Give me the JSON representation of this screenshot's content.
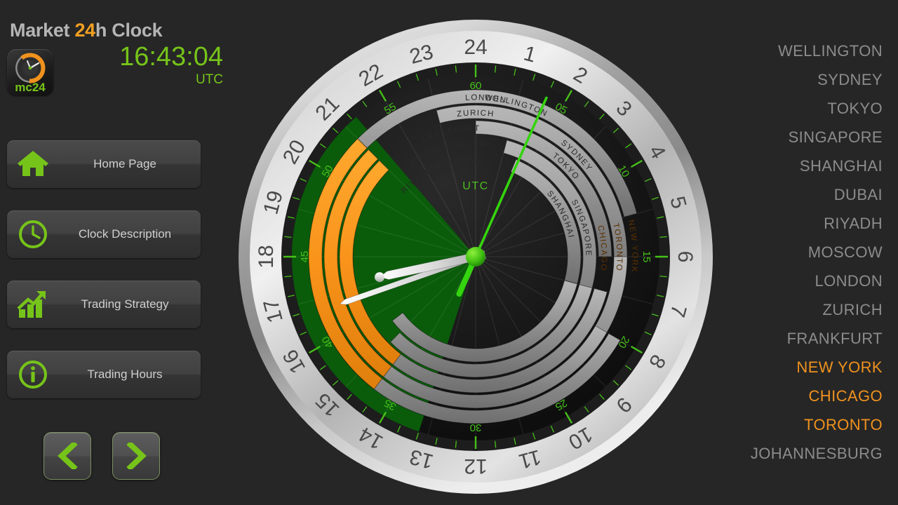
{
  "header": {
    "title_prefix": "Market ",
    "title_accent": "24",
    "title_suffix": "h Clock",
    "time": "16:43:04",
    "timezone": "UTC",
    "logo_text": "mc24"
  },
  "menu": {
    "items": [
      {
        "label": "Home Page",
        "icon": "home-icon"
      },
      {
        "label": "Clock Description",
        "icon": "clock-icon"
      },
      {
        "label": "Trading Strategy",
        "icon": "chart-growth-icon"
      },
      {
        "label": "Trading Hours",
        "icon": "info-icon"
      }
    ]
  },
  "pagination": {
    "previous_icon": "chevron-left-icon",
    "next_icon": "chevron-right-icon"
  },
  "colors": {
    "accent_orange": "#f0921e",
    "accent_green": "#76c419",
    "dial_green_sector": "#0a5c0a",
    "text_grey": "#8c8c8c",
    "background": "#262626"
  },
  "clock": {
    "center_label": "UTC",
    "hour_numerals": [
      "1",
      "2",
      "3",
      "4",
      "5",
      "6",
      "7",
      "8",
      "9",
      "10",
      "11",
      "12",
      "13",
      "14",
      "15",
      "16",
      "17",
      "18",
      "19",
      "20",
      "21",
      "22",
      "23",
      "24"
    ],
    "minute_numerals": [
      "60",
      "05",
      "10",
      "15",
      "20",
      "25",
      "30",
      "35",
      "40",
      "45",
      "50",
      "55"
    ],
    "hour_hand_value": 16.72,
    "minute_hand_value": 43,
    "second_hand_value": 4,
    "open_sector_start_hour": 13.2,
    "open_sector_end_hour": 21.3
  },
  "market_arcs": [
    {
      "city": "WELLINGTON",
      "ring": 0,
      "start_hour": 21.0,
      "end_hour": 5.0,
      "status": "closed"
    },
    {
      "city": "SYDNEY",
      "ring": 1,
      "start_hour": 23.0,
      "end_hour": 7.0,
      "status": "closed"
    },
    {
      "city": "TOKYO",
      "ring": 2,
      "start_hour": 0.0,
      "end_hour": 6.0,
      "status": "closed"
    },
    {
      "city": "SINGAPORE",
      "ring": 3,
      "start_hour": 1.0,
      "end_hour": 9.0,
      "status": "closed"
    },
    {
      "city": "SHANGHAI",
      "ring": 4,
      "start_hour": 1.5,
      "end_hour": 7.0,
      "status": "closed"
    },
    {
      "city": "DUBAI",
      "ring": 1,
      "start_hour": 6.0,
      "end_hour": 11.0,
      "status": "closed"
    },
    {
      "city": "RIYADH",
      "ring": 4,
      "start_hour": 7.0,
      "end_hour": 12.0,
      "status": "closed"
    },
    {
      "city": "MOSCOW",
      "ring": 4,
      "start_hour": 7.0,
      "end_hour": 15.5,
      "status": "closed"
    },
    {
      "city": "JOHANNESBURG",
      "ring": 3,
      "start_hour": 7.0,
      "end_hour": 15.0,
      "status": "closed"
    },
    {
      "city": "FRANKFURT",
      "ring": 2,
      "start_hour": 7.0,
      "end_hour": 15.5,
      "status": "closed"
    },
    {
      "city": "ZURICH",
      "ring": 1,
      "start_hour": 8.0,
      "end_hour": 16.0,
      "status": "closed"
    },
    {
      "city": "LONDON",
      "ring": 0,
      "start_hour": 8.0,
      "end_hour": 16.5,
      "status": "closed"
    },
    {
      "city": "NEW YORK",
      "ring": 0,
      "start_hour": 14.5,
      "end_hour": 21.0,
      "status": "open"
    },
    {
      "city": "TORONTO",
      "ring": 1,
      "start_hour": 14.5,
      "end_hour": 21.0,
      "status": "open"
    },
    {
      "city": "CHICAGO",
      "ring": 2,
      "start_hour": 14.5,
      "end_hour": 21.0,
      "status": "open"
    }
  ],
  "city_list": [
    {
      "label": "WELLINGTON",
      "status": "closed"
    },
    {
      "label": "SYDNEY",
      "status": "closed"
    },
    {
      "label": "TOKYO",
      "status": "closed"
    },
    {
      "label": "SINGAPORE",
      "status": "closed"
    },
    {
      "label": "SHANGHAI",
      "status": "closed"
    },
    {
      "label": "DUBAI",
      "status": "closed"
    },
    {
      "label": "RIYADH",
      "status": "closed"
    },
    {
      "label": "MOSCOW",
      "status": "closed"
    },
    {
      "label": "LONDON",
      "status": "closed"
    },
    {
      "label": "ZURICH",
      "status": "closed"
    },
    {
      "label": "FRANKFURT",
      "status": "closed"
    },
    {
      "label": "NEW YORK",
      "status": "open"
    },
    {
      "label": "CHICAGO",
      "status": "open"
    },
    {
      "label": "TORONTO",
      "status": "open"
    },
    {
      "label": "JOHANNESBURG",
      "status": "closed"
    }
  ]
}
